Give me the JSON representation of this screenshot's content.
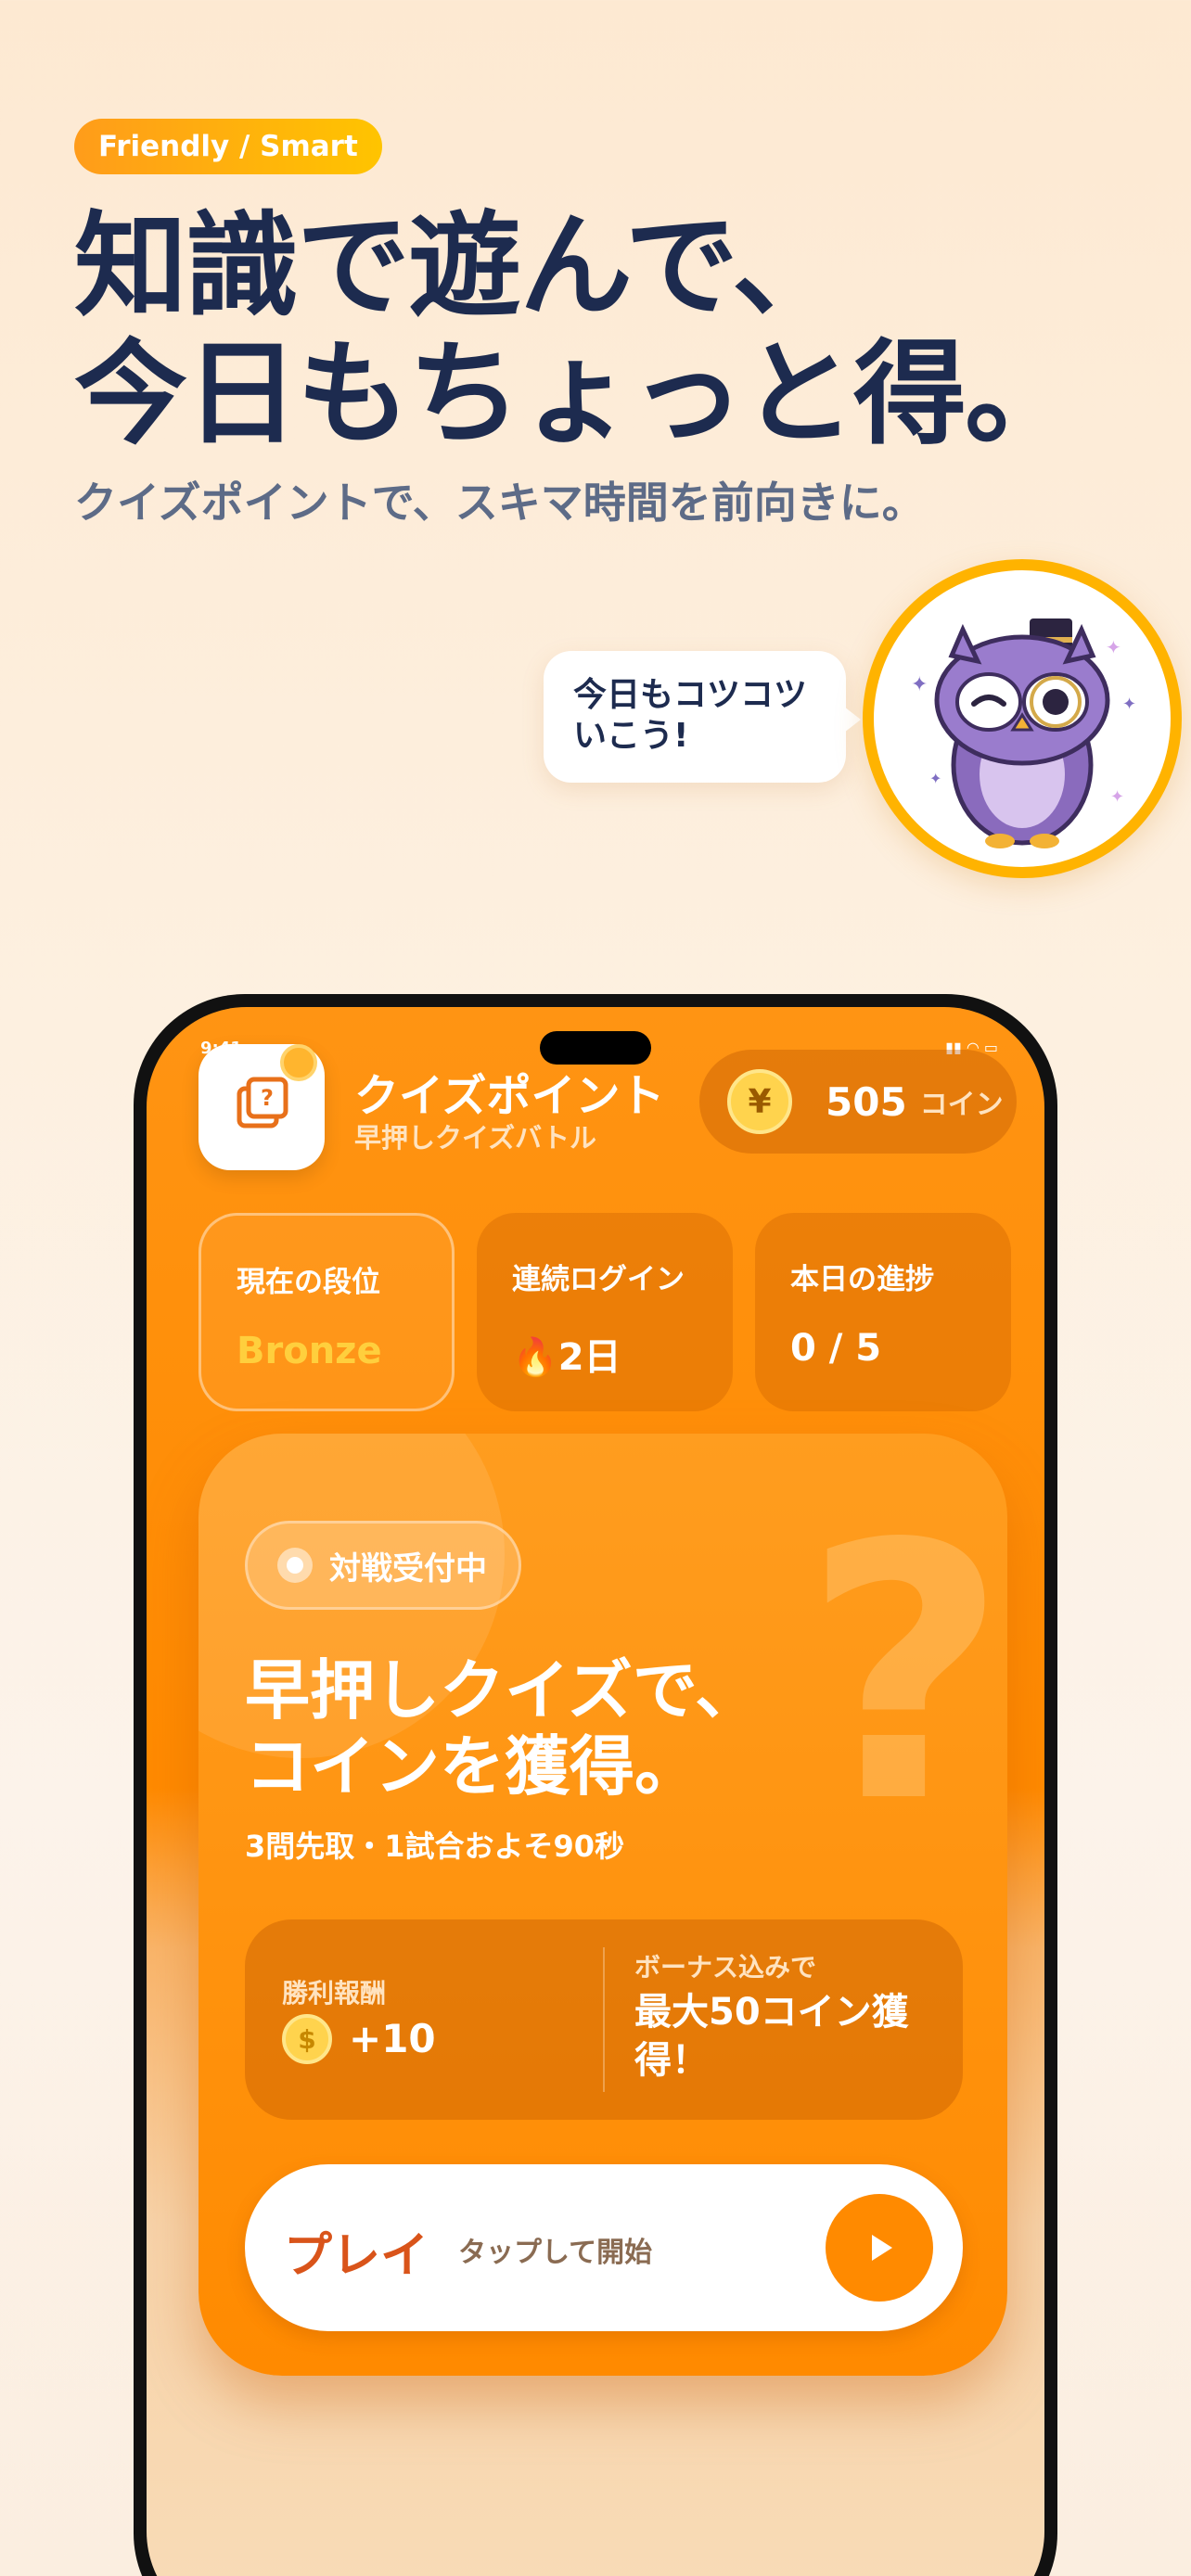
{
  "hero": {
    "badge": "Friendly / Smart",
    "headline_line1": "知識で遊んで、",
    "headline_line2": "今日もちょっと得。",
    "subhead": "クイズポイントで、スキマ時間を前向きに。",
    "bubble": "今日もコツコツいこう!"
  },
  "status_bar": {
    "time": "9:41"
  },
  "app": {
    "title": "クイズポイント",
    "subtitle": "早押しクイズバトル",
    "coin_symbol": "¥",
    "coin_count": "505",
    "coin_unit": "コイン"
  },
  "stats": [
    {
      "label": "現在の段位",
      "value": "Bronze"
    },
    {
      "label": "連続ログイン",
      "value": "🔥2日"
    },
    {
      "label": "本日の進捗",
      "value": "0 / 5"
    }
  ],
  "battle": {
    "status": "対戦受付中",
    "title_line1": "早押しクイズで、",
    "title_line2": "コインを獲得。",
    "rules": "3問先取・1試合およそ90秒",
    "reward_label": "勝利報酬",
    "reward_value": "+10",
    "bonus_label": "ボーナス込みで",
    "bonus_value": "最大50コイン獲得！",
    "play_label": "プレイ",
    "play_hint": "タップして開始"
  },
  "colors": {
    "accent": "#ff8a00",
    "navy": "#1d2b4f",
    "gold": "#ffcf3d"
  }
}
